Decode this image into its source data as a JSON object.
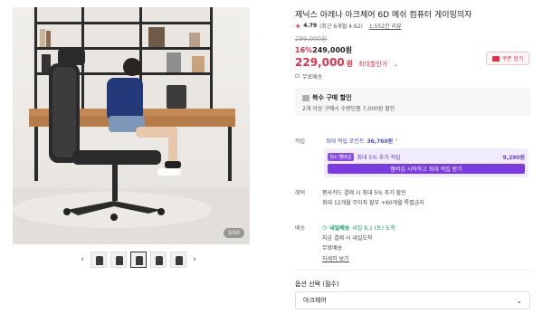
{
  "gallery": {
    "counter": "3/10",
    "prev_icon": "chevron-left-icon",
    "next_icon": "chevron-right-icon",
    "thumbs": [
      "thumb-1",
      "thumb-2",
      "thumb-3",
      "thumb-4",
      "thumb-5"
    ]
  },
  "product": {
    "title": "제닉스 아레나 아크체어 6D 메쉬 컴퓨터 게이밍의자",
    "rating": "4.79",
    "rating_detail": "(최근 6개월 4.62)",
    "reviews": "1,552건 리뷰",
    "original_price": "299,000원",
    "discount_pct": "16%",
    "discount_price": "249,000원",
    "sale_price": "229,000",
    "won": "원",
    "max_discount_label": "최대할인가",
    "coupon_label": "쿠폰 받기",
    "shipping_free": "무료배송"
  },
  "multi": {
    "title": "복수 구매 할인",
    "desc": "2개 이상 구매시 수량단품 7,000원 할인"
  },
  "points": {
    "label": "적립",
    "line": "최대 적립 포인트",
    "value": "36,760원",
    "tag": "N+ 멤버십",
    "row_text": "최대 5% 추가 적립",
    "row_val": "9,290원",
    "button": "멤버십 시작하고 최대 적립 받기"
  },
  "benefit": {
    "label": "혜택",
    "line1": "평사카드 결제 시 최대 5% 추가 할인",
    "line2": "최대 12개월 무이자 할부 +60개월 특별금리"
  },
  "delivery": {
    "label": "배송",
    "badge": "내일배송",
    "eta": "내일 8.1 (토) 도착",
    "line2": "지금 결제 시 내일도착",
    "line3": "무료배송",
    "more": "자세히 보기"
  },
  "options": {
    "label": "옵션 선택 (필수)",
    "selected": "아크체어"
  },
  "colors": {
    "accent": "#e4314a",
    "point": "#7a3ce0",
    "delivery": "#1aa366"
  }
}
